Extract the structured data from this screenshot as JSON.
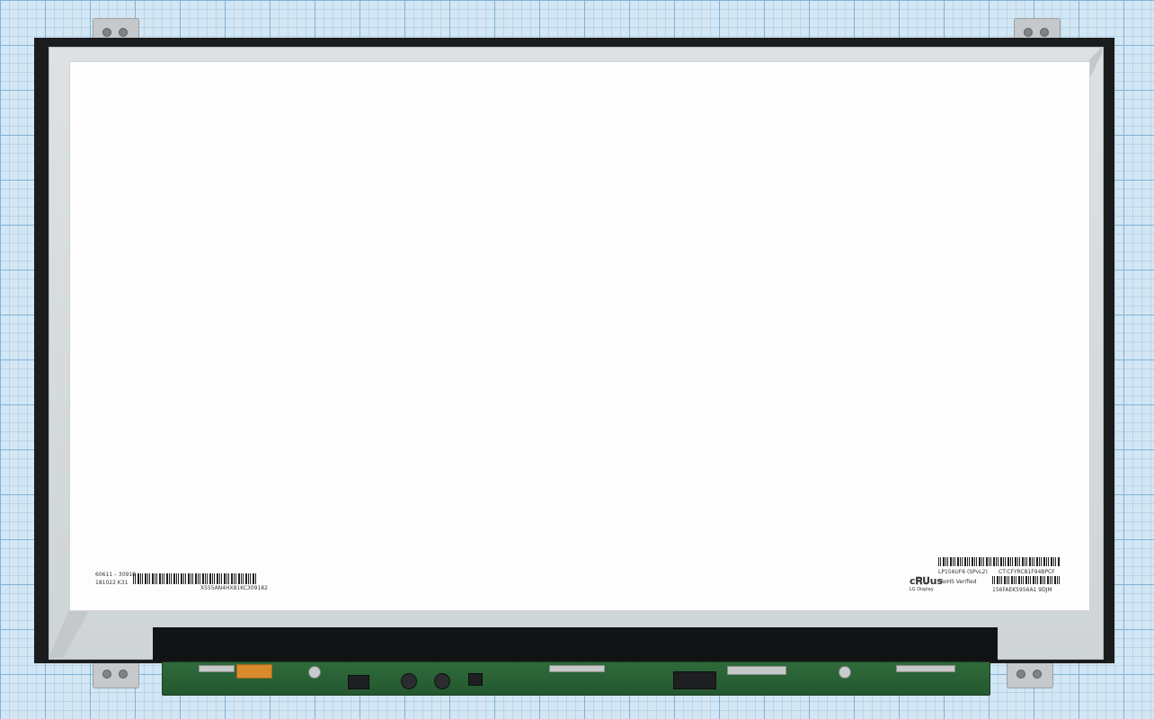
{
  "scene": {
    "subject": "LCD panel",
    "background": "graph paper",
    "colors": {
      "grid_bg": "#d3e6f3",
      "grid_major": "#7fb2d8",
      "grid_minor": "#b7d4ea",
      "bezel": "#1b1c1d",
      "frame_metal": "#d5d9dc",
      "active_area": "#fdfdfd",
      "pcb_green": "#2f6b3a"
    }
  },
  "labels": {
    "left_line1": "60611 – 30918",
    "left_line2": "181022   K31",
    "left_barcode_text": "X555AN4HX81KC309182",
    "right_barcode_text_top": "LP156UF6 (SPvL2)",
    "right_ct_text": "CT:CFYRC81F94BPCF",
    "right_rohs": "RoHS Verified",
    "right_serial": "156FAEK5956A1 9DJM",
    "ul_mark": "c𝐑𝐔us",
    "lg_logo_text": "LG Display"
  }
}
